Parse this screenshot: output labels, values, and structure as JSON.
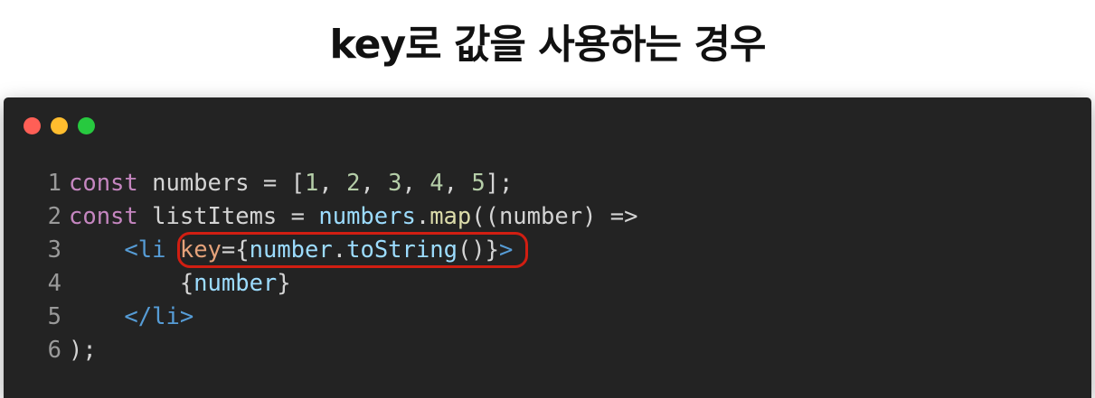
{
  "slide": {
    "title": "key로 값을 사용하는 경우"
  },
  "window": {
    "controls": {
      "close_icon": "red-dot",
      "minimize_icon": "yellow-dot",
      "maximize_icon": "green-dot"
    }
  },
  "code": {
    "lines": [
      {
        "num": "1",
        "tokens": [
          {
            "t": "const",
            "c": "kw"
          },
          {
            "t": " numbers = [",
            "c": "pun"
          },
          {
            "t": "1",
            "c": "num"
          },
          {
            "t": ", ",
            "c": "pun"
          },
          {
            "t": "2",
            "c": "num"
          },
          {
            "t": ", ",
            "c": "pun"
          },
          {
            "t": "3",
            "c": "num"
          },
          {
            "t": ", ",
            "c": "pun"
          },
          {
            "t": "4",
            "c": "num"
          },
          {
            "t": ", ",
            "c": "pun"
          },
          {
            "t": "5",
            "c": "num"
          },
          {
            "t": "];",
            "c": "pun"
          }
        ]
      },
      {
        "num": "2",
        "tokens": [
          {
            "t": "const",
            "c": "kw"
          },
          {
            "t": " listItems = ",
            "c": "pun"
          },
          {
            "t": "numbers",
            "c": "var"
          },
          {
            "t": ".",
            "c": "pun"
          },
          {
            "t": "map",
            "c": "fn"
          },
          {
            "t": "((number) =>",
            "c": "pun"
          }
        ]
      },
      {
        "num": "3",
        "tokens": [
          {
            "t": "    ",
            "c": "pun"
          },
          {
            "t": "<li",
            "c": "tag"
          },
          {
            "t": " ",
            "c": "pun"
          },
          {
            "t": "key",
            "c": "attr"
          },
          {
            "t": "={",
            "c": "pun"
          },
          {
            "t": "number",
            "c": "jsx"
          },
          {
            "t": ".",
            "c": "pun"
          },
          {
            "t": "toString",
            "c": "jsx"
          },
          {
            "t": "()}",
            "c": "pun"
          },
          {
            "t": ">",
            "c": "tag"
          }
        ]
      },
      {
        "num": "4",
        "tokens": [
          {
            "t": "        {",
            "c": "pun"
          },
          {
            "t": "number",
            "c": "jsx"
          },
          {
            "t": "}",
            "c": "pun"
          }
        ]
      },
      {
        "num": "5",
        "tokens": [
          {
            "t": "    ",
            "c": "pun"
          },
          {
            "t": "</li>",
            "c": "tag"
          }
        ]
      },
      {
        "num": "6",
        "tokens": [
          {
            "t": ");",
            "c": "pun"
          }
        ]
      }
    ]
  },
  "colors": {
    "background": "#ffffff",
    "editor_bg": "#232323",
    "highlight_border": "#d11e12",
    "close": "#ff5f56",
    "minimize": "#ffbd2e",
    "maximize": "#27c93f"
  }
}
